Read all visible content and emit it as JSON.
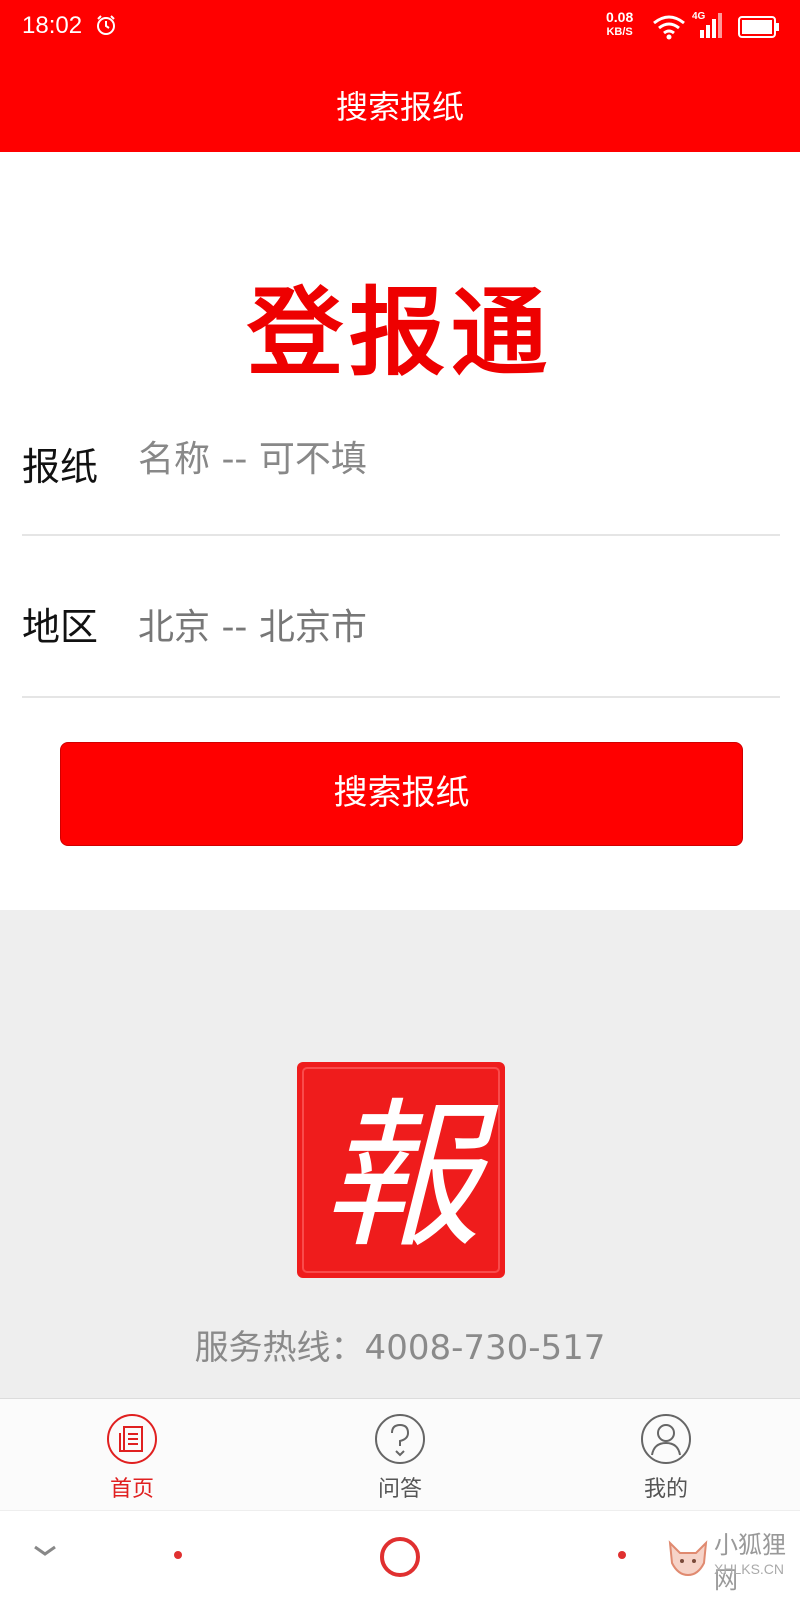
{
  "status_bar": {
    "time": "18:02",
    "net_speed_value": "0.08",
    "net_speed_unit": "KB/S",
    "network_type": "4G"
  },
  "header": {
    "title": "搜索报纸"
  },
  "brand": {
    "title": "登报通"
  },
  "form": {
    "newspaper_label": "报纸",
    "newspaper_placeholder": "名称 -- 可不填",
    "region_label": "地区",
    "region_value": "北京 -- 北京市"
  },
  "search_button": {
    "label": "搜索报纸"
  },
  "footer": {
    "seal_char": "報",
    "hotline": "服务热线：4008-730-517"
  },
  "tabs": [
    {
      "label": "首页",
      "icon": "newspaper-icon",
      "active": true
    },
    {
      "label": "问答",
      "icon": "question-icon",
      "active": false
    },
    {
      "label": "我的",
      "icon": "user-icon",
      "active": false
    }
  ],
  "watermark": {
    "text": "小狐狸网",
    "sub": "XHLKS.CN"
  },
  "colors": {
    "brand_red": "#ff0000",
    "active_tab": "#e02020",
    "panel_gray": "#eeeeee"
  }
}
